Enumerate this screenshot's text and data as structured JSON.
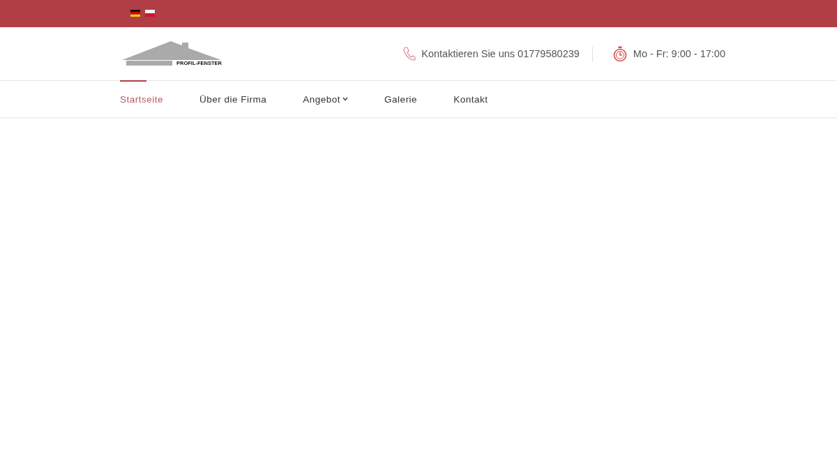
{
  "top_bar": {
    "languages": [
      {
        "kind": "de"
      },
      {
        "kind": "pl"
      }
    ]
  },
  "header": {
    "logo": {
      "text": "PROFIL-FENSTER"
    },
    "contact": {
      "text": "Kontaktieren Sie uns 01779580239"
    },
    "hours": {
      "text": "Mo - Fr: 9:00 - 17:00"
    }
  },
  "nav": {
    "items": [
      {
        "label": "Startseite",
        "selected": true,
        "has_dropdown": false
      },
      {
        "label": "Über die Firma",
        "selected": false,
        "has_dropdown": false
      },
      {
        "label": "Angebot",
        "selected": false,
        "has_dropdown": true
      },
      {
        "label": "Galerie",
        "selected": false,
        "has_dropdown": false
      },
      {
        "label": "Kontakt",
        "selected": false,
        "has_dropdown": false
      }
    ]
  }
}
